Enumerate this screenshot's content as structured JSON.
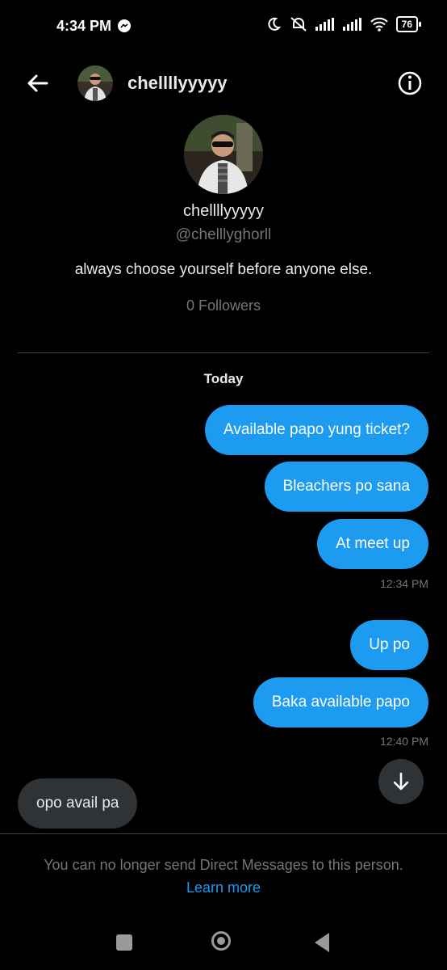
{
  "status_bar": {
    "time": "4:34 PM",
    "battery": "76",
    "icons": [
      "messenger-icon",
      "moon-icon",
      "silent-icon",
      "signal-icon",
      "signal-icon",
      "wifi-icon",
      "battery-icon"
    ]
  },
  "header": {
    "name": "chellllyyyyy",
    "back_icon": "arrow-left-icon",
    "info_icon": "info-icon"
  },
  "profile": {
    "name": "chellllyyyyy",
    "handle": "@chelllyghorll",
    "bio": "always choose yourself before anyone else.",
    "followers": "0 Followers"
  },
  "conversation": {
    "date_label": "Today",
    "messages": [
      {
        "text": "Available papo yung ticket?",
        "direction": "sent"
      },
      {
        "text": "Bleachers po sana",
        "direction": "sent"
      },
      {
        "text": "At meet up",
        "direction": "sent"
      },
      {
        "text": "Up po",
        "direction": "sent"
      },
      {
        "text": "Baka available papo",
        "direction": "sent"
      },
      {
        "text": "opo avail pa",
        "direction": "received"
      }
    ],
    "timestamps": [
      "12:34 PM",
      "12:40 PM"
    ]
  },
  "footer": {
    "notice": "You can no longer send Direct Messages to this person.",
    "learn_more": "Learn more"
  },
  "colors": {
    "background": "#000000",
    "sent_bubble": "#1d9bf0",
    "received_bubble": "#2f3336",
    "secondary_text": "#71767b",
    "link": "#1d9bf0"
  }
}
